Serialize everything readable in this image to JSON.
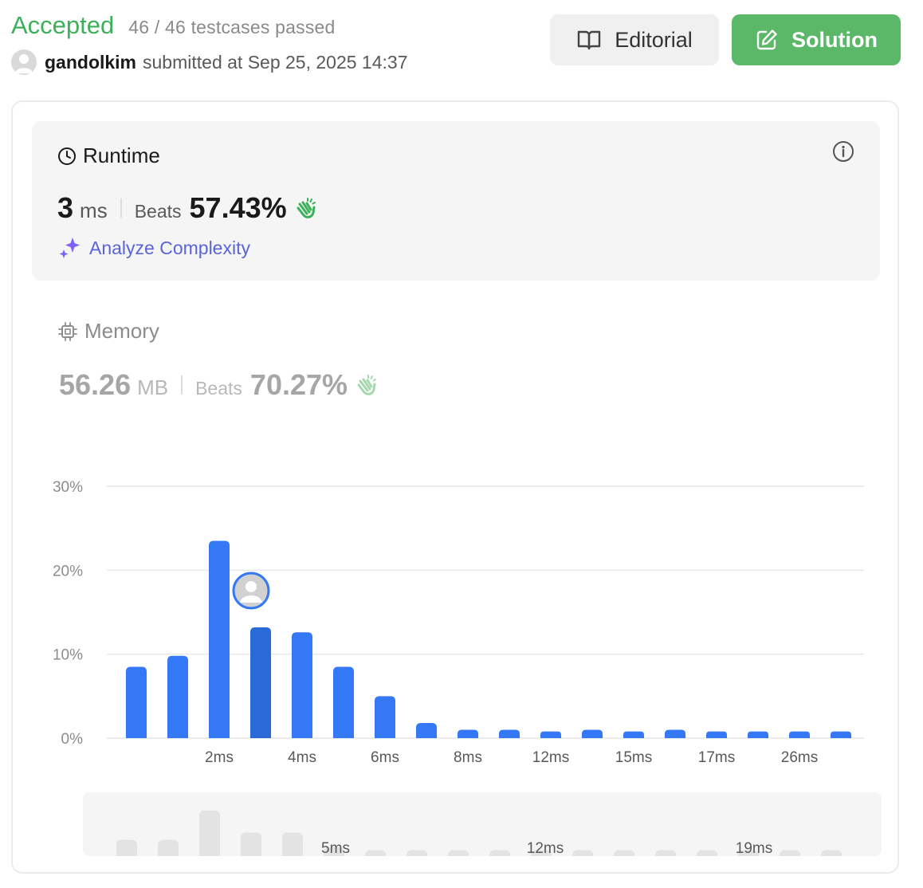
{
  "header": {
    "status": "Accepted",
    "testcases": "46 / 46 testcases passed",
    "username": "gandolkim",
    "submitted": "submitted at Sep 25, 2025 14:37",
    "editorial_label": "Editorial",
    "solution_label": "Solution"
  },
  "runtime": {
    "title": "Runtime",
    "value": "3",
    "unit": "ms",
    "beats_label": "Beats",
    "beats": "57.43%",
    "analyze_label": "Analyze Complexity"
  },
  "memory": {
    "title": "Memory",
    "value": "56.26",
    "unit": "MB",
    "beats_label": "Beats",
    "beats": "70.27%"
  },
  "colors": {
    "accepted": "#3eaf5b",
    "solution_button": "#5bb868",
    "bar": "#3478f6",
    "bar_active": "#2a6ad8",
    "analyze": "#5a64d8",
    "clap_active": "#3eaf5b",
    "clap_inactive": "#a6d8b0"
  },
  "chart_data": {
    "type": "bar",
    "ylim": [
      0,
      30
    ],
    "yticks": [
      "30%",
      "20%",
      "10%",
      "0%"
    ],
    "values": [
      8.5,
      9.8,
      23.5,
      13.2,
      12.6,
      8.5,
      5.0,
      1.8,
      1.0,
      1.0,
      0.8,
      1.0,
      0.8,
      1.0,
      0.8,
      0.8,
      0.8,
      0.8
    ],
    "x_tick_labels": [
      "",
      "",
      "2ms",
      "",
      "4ms",
      "",
      "6ms",
      "",
      "8ms",
      "",
      "12ms",
      "",
      "15ms",
      "",
      "17ms",
      "",
      "26ms",
      ""
    ],
    "highlight_index": 3,
    "overview": {
      "values": [
        4,
        4,
        12,
        6,
        6,
        2,
        1.2,
        1.2,
        1.2,
        1.2,
        1.2,
        1.2,
        1.2,
        1.2,
        1.2,
        1.2,
        1.2,
        1.2
      ],
      "labels": [
        "5ms",
        "12ms",
        "19ms"
      ]
    }
  }
}
